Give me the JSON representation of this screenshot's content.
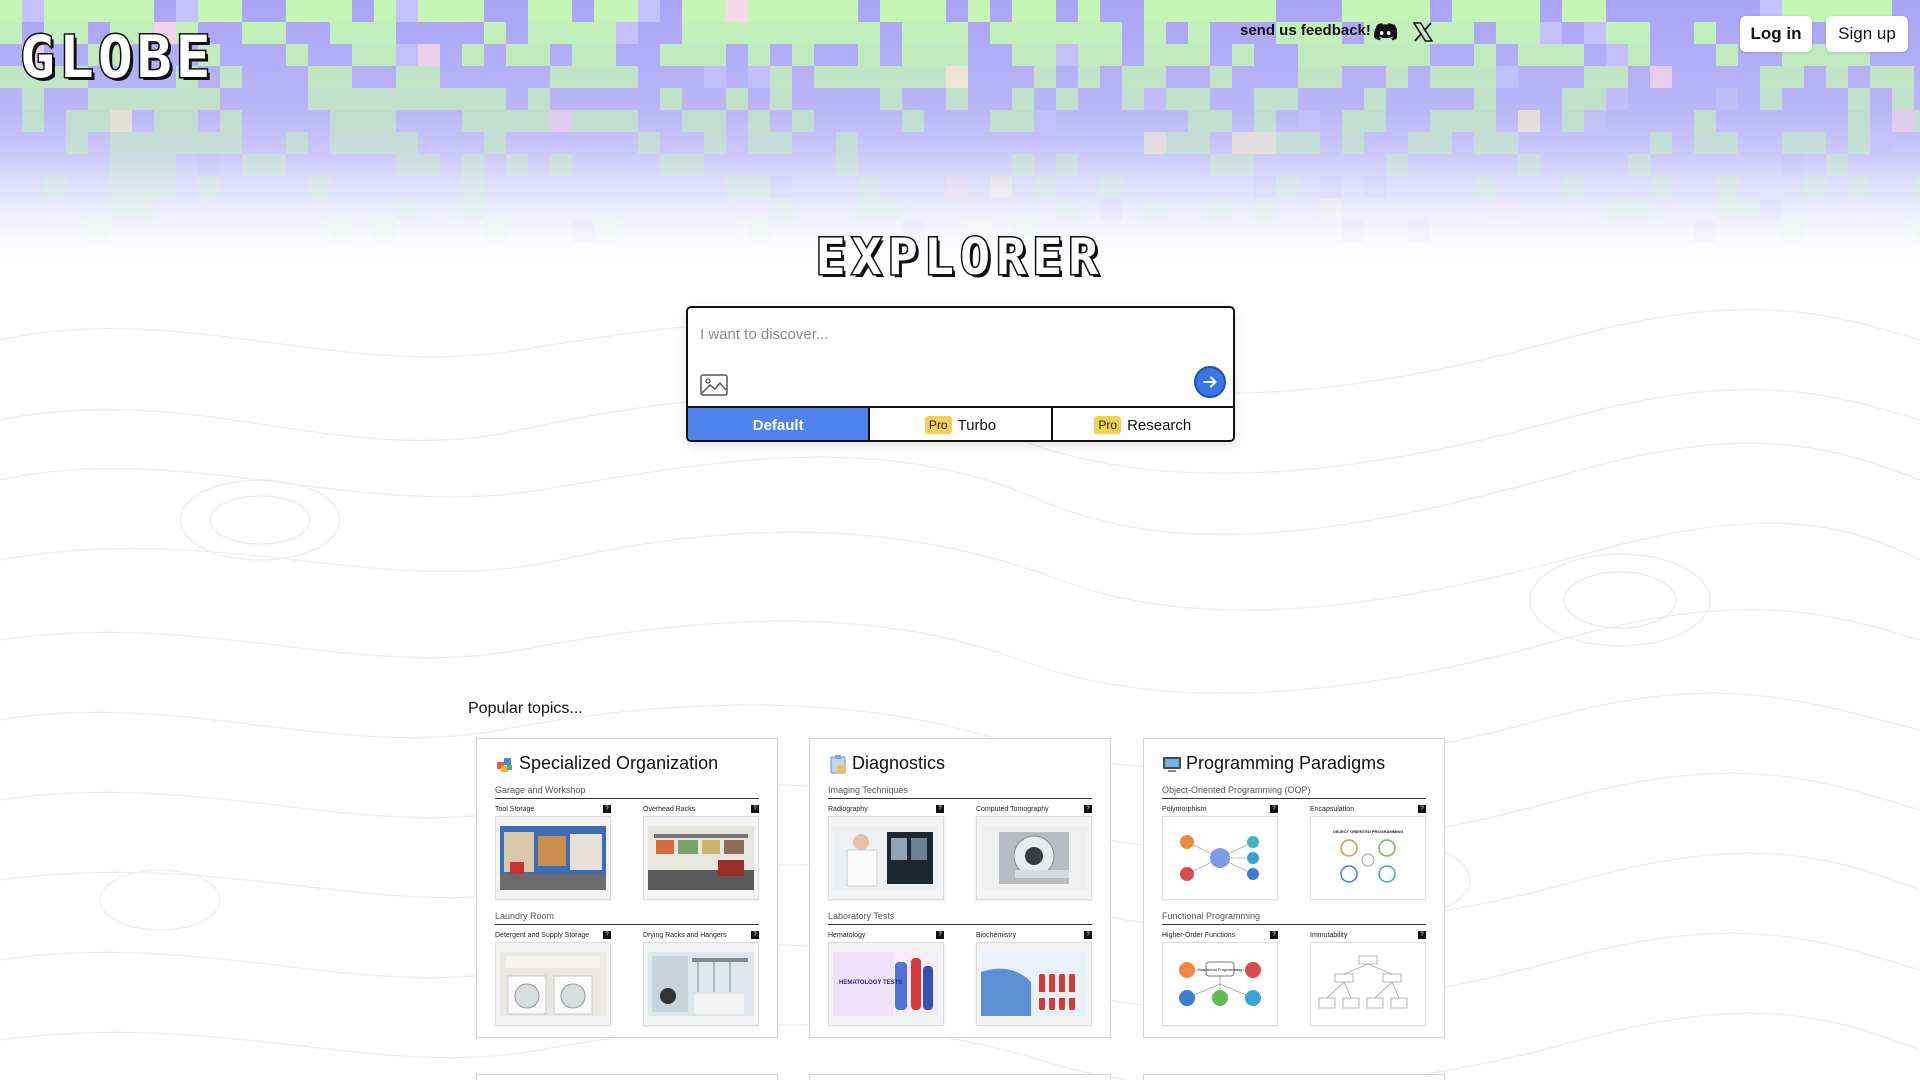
{
  "header": {
    "logo": "GLOBE",
    "feedback": "send us feedback!",
    "discord_icon": "discord-icon",
    "x_icon": "x-logo-icon",
    "login": "Log in",
    "signup": "Sign up"
  },
  "hero": {
    "title": "EXPLORER"
  },
  "search": {
    "placeholder": "I want to discover...",
    "value": "",
    "image_icon": "image-icon",
    "submit_icon": "arrow-right-icon",
    "modes": [
      {
        "label": "Default",
        "badge": "",
        "active": true
      },
      {
        "label": "Turbo",
        "badge": "Pro",
        "active": false
      },
      {
        "label": "Research",
        "badge": "Pro",
        "active": false
      }
    ]
  },
  "popular": {
    "heading": "Popular topics...",
    "cards": [
      {
        "title": "Specialized Organization",
        "sections": [
          {
            "label": "Garage and Workshop",
            "items": [
              "Tool Storage",
              "Overhead Racks"
            ]
          },
          {
            "label": "Laundry Room",
            "items": [
              "Detergent and Supply Storage",
              "Drying Racks and Hangers"
            ]
          }
        ]
      },
      {
        "title": "Diagnostics",
        "sections": [
          {
            "label": "Imaging Techniques",
            "items": [
              "Radiography",
              "Computed Tomography"
            ]
          },
          {
            "label": "Laboratory Tests",
            "items": [
              "Hematology",
              "Biochemistry"
            ]
          }
        ]
      },
      {
        "title": "Programming Paradigms",
        "sections": [
          {
            "label": "Object-Oriented Programming (OOP)",
            "items": [
              "Polymorphism",
              "Encapsulation"
            ]
          },
          {
            "label": "Functional Programming",
            "items": [
              "Higher-Order Functions",
              "Immutability"
            ]
          }
        ]
      }
    ],
    "info_badge": "?",
    "thumb_captions": {
      "hematology": "HEMATOLOGY TESTS",
      "oop": "OBJECT ORIENTED PROGRAMMING",
      "fp": "Functional Programming"
    }
  },
  "colors": {
    "accent": "#4f83ee",
    "submit": "#3b74e6",
    "pro_badge": "#f5d24b",
    "banner_purple": "#a9a3f7",
    "banner_green": "#c4f5b4"
  }
}
